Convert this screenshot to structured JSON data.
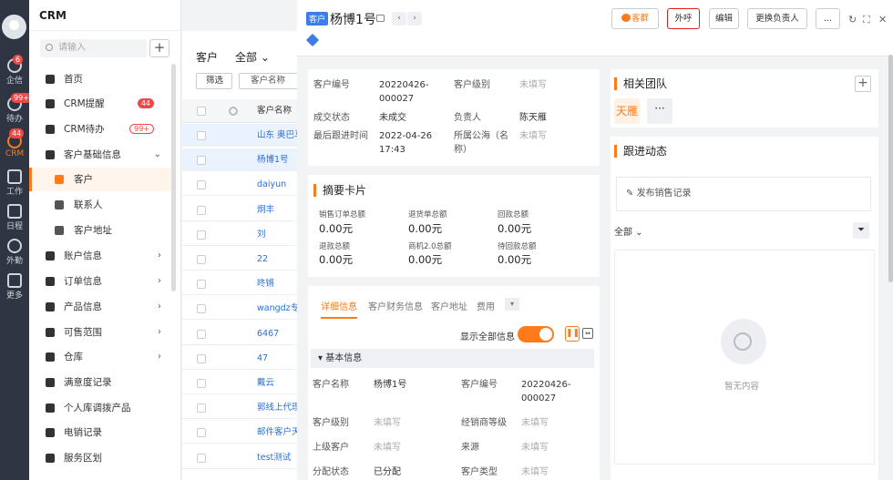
{
  "rail": {
    "items": [
      {
        "label": "企信",
        "badge": "6"
      },
      {
        "label": "待办",
        "badge": "99+"
      },
      {
        "label": "CRM",
        "badge": "44"
      },
      {
        "label": "工作"
      },
      {
        "label": "日程"
      },
      {
        "label": "外勤"
      },
      {
        "label": "更多"
      }
    ]
  },
  "nav": {
    "title": "CRM",
    "search_placeholder": "请输入",
    "items": [
      {
        "label": "首页"
      },
      {
        "label": "CRM提醒",
        "count": "44"
      },
      {
        "label": "CRM待办",
        "count": "99+"
      },
      {
        "label": "客户基础信息",
        "arrow": "⌄"
      },
      {
        "label": "客户"
      },
      {
        "label": "联系人"
      },
      {
        "label": "客户地址"
      },
      {
        "label": "账户信息",
        "arrow": "›"
      },
      {
        "label": "订单信息",
        "arrow": "›"
      },
      {
        "label": "产品信息",
        "arrow": "›"
      },
      {
        "label": "可售范围",
        "arrow": "›"
      },
      {
        "label": "仓库",
        "arrow": "›"
      },
      {
        "label": "满意度记录"
      },
      {
        "label": "个人库调拨产品"
      },
      {
        "label": "电销记录"
      },
      {
        "label": "服务区划"
      }
    ]
  },
  "list": {
    "title": "客户",
    "scope": "全部 ⌄",
    "filter_label": "筛选",
    "name_col_placeholder": "客户名称",
    "header_name": "客户名称",
    "rows": [
      "山东 奥巴马",
      "杨博1号",
      "daiyun",
      "炯丰",
      "刘",
      "22",
      "咚锵",
      "wangdz专属",
      "6467",
      "47",
      "戴云",
      "郭线上代理客",
      "邮件客户天顺",
      "test测试"
    ]
  },
  "detail": {
    "tag": "客户",
    "name": "杨博1号",
    "buttons": {
      "kequn": "客群",
      "waihu": "外呼",
      "bianji": "编辑",
      "genghuan": "更换负责人",
      "more": "..."
    },
    "info": {
      "code_label": "客户编号",
      "code_value": "20220426-000027",
      "level_label": "客户级别",
      "level_value": "未填写",
      "deal_label": "成交状态",
      "deal_value": "未成交",
      "owner_label": "负责人",
      "owner_value": "陈天雁",
      "last_label": "最后跟进时间",
      "last_value": "2022-04-26 17:43",
      "pool_label": "所属公海（名称）",
      "pool_value": "未填写"
    },
    "summary": {
      "title": "摘要卡片",
      "cells": [
        {
          "label": "销售订单总额",
          "value": "0.00元"
        },
        {
          "label": "退货单总额",
          "value": "0.00元"
        },
        {
          "label": "回款总额",
          "value": "0.00元"
        },
        {
          "label": "退款总额",
          "value": "0.00元"
        },
        {
          "label": "商机2.0总额",
          "value": "0.00元"
        },
        {
          "label": "待回款总额",
          "value": "0.00元"
        }
      ]
    },
    "tabs": [
      "详细信息",
      "客户财务信息",
      "客户地址",
      "费用"
    ],
    "show_all": "显示全部信息",
    "basic_section": "基本信息",
    "fields": [
      {
        "label": "客户名称",
        "value": "杨博1号"
      },
      {
        "label": "客户编号",
        "value": "20220426-000027"
      },
      {
        "label": "客户级别",
        "value": "未填写"
      },
      {
        "label": "经销商等级",
        "value": "未填写"
      },
      {
        "label": "上级客户",
        "value": "未填写"
      },
      {
        "label": "来源",
        "value": "未填写"
      },
      {
        "label": "分配状态",
        "value": "已分配"
      },
      {
        "label": "客户类型",
        "value": "未填写"
      }
    ]
  },
  "side": {
    "team_title": "相关团队",
    "team_member": "天雁",
    "follow_title": "跟进动态",
    "publish": "发布销售记录",
    "filter": "全部 ⌄",
    "empty": "暂无内容"
  },
  "colors": {
    "accent": "#ff7a1a",
    "link": "#2a6fd6",
    "danger": "#e02020"
  }
}
